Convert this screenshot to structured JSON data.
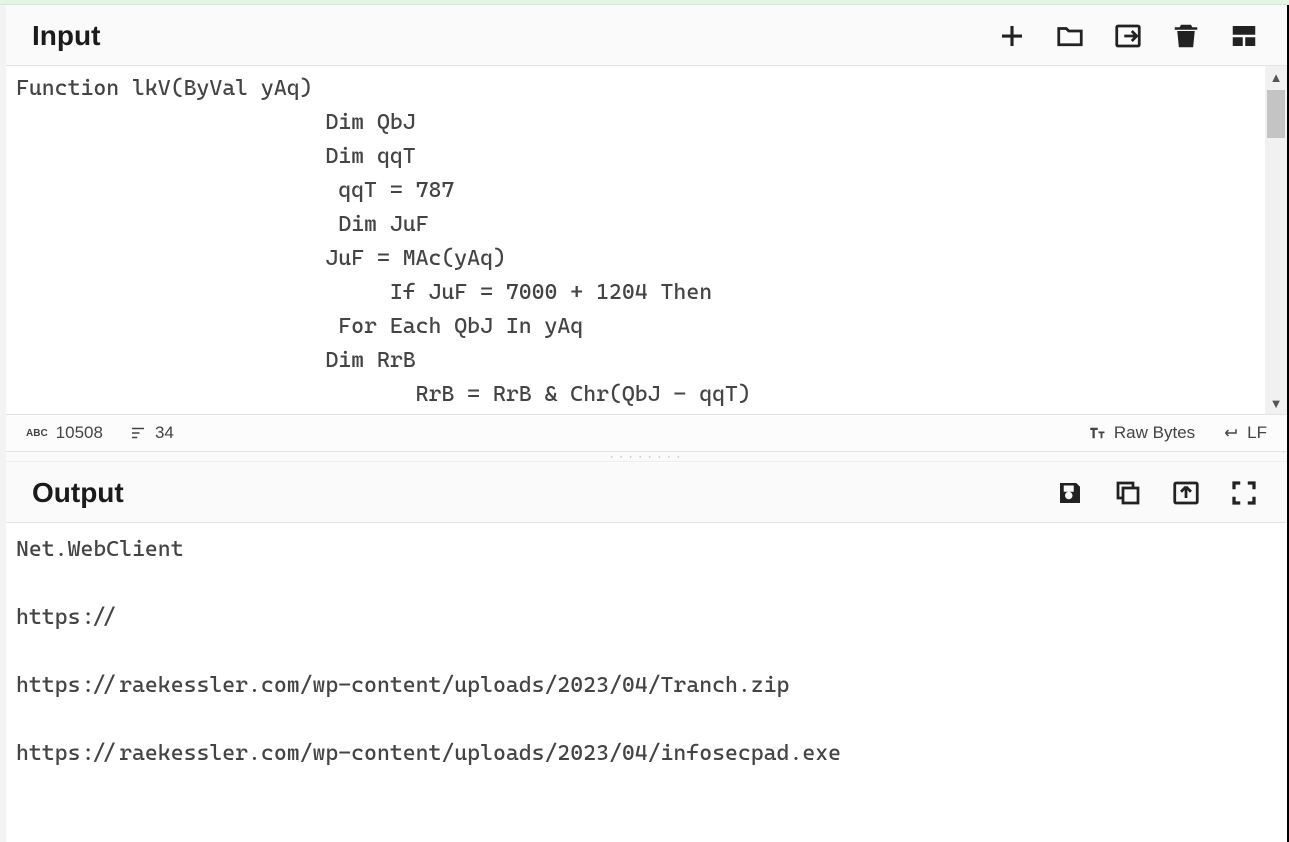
{
  "input": {
    "title": "Input",
    "code": "Function lkV(ByVal yAq)\n                        Dim QbJ\n                        Dim qqT\n                         qqT = 787\n                         Dim JuF\n                        JuF = MAc(yAq)\n                             If JuF = 7000 + 1204 Then\n                         For Each QbJ In yAq\n                        Dim RrB\n                               RrB = RrB & Chr(QbJ - qqT)",
    "actions": {
      "new": "New",
      "open_folder": "Open",
      "open_file": "Open file as input",
      "delete": "Clear",
      "reset_layout": "Reset layout"
    }
  },
  "status": {
    "char_count": "10508",
    "line_count": "34",
    "encoding": "Raw Bytes",
    "eol": "LF"
  },
  "output": {
    "title": "Output",
    "code": "Net.WebClient\n\nhttps://\n\nhttps://raekessler.com/wp-content/uploads/2023/04/Tranch.zip\n\nhttps://raekessler.com/wp-content/uploads/2023/04/infosecpad.exe",
    "actions": {
      "save": "Save",
      "copy": "Copy",
      "move_to_input": "Move output to input",
      "maximize": "Maximize"
    }
  }
}
